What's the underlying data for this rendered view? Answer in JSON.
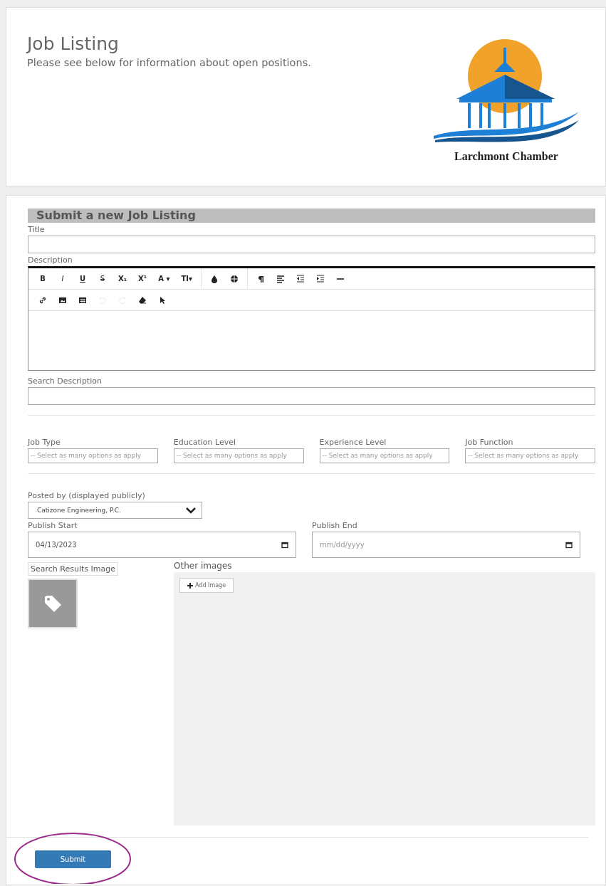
{
  "header": {
    "title": "Job Listing",
    "subtitle": "Please see below for information about open positions.",
    "logo_text": "Larchmont Chamber"
  },
  "form": {
    "heading": "Submit a new Job Listing",
    "title_field": {
      "label": "Title"
    },
    "description": {
      "label": "Description",
      "toolbar": [
        [
          [
            {
              "kind": "bold",
              "label": "B",
              "disabled": false
            },
            {
              "kind": "italic",
              "label": "I",
              "disabled": false
            },
            {
              "kind": "underline",
              "label": "U",
              "disabled": false
            },
            {
              "kind": "strike",
              "label": "S",
              "disabled": false
            },
            {
              "kind": "text",
              "label": "X₁",
              "disabled": false
            },
            {
              "kind": "text",
              "label": "X¹",
              "disabled": false
            },
            {
              "kind": "text",
              "label": "A ▾",
              "disabled": false
            },
            {
              "kind": "text",
              "label": "TI▾",
              "disabled": false
            }
          ],
          [
            {
              "kind": "drop",
              "disabled": false
            },
            {
              "kind": "globe",
              "disabled": false
            }
          ],
          [
            {
              "kind": "paragraph",
              "disabled": false
            },
            {
              "kind": "align",
              "disabled": false
            },
            {
              "kind": "outdent",
              "disabled": false
            },
            {
              "kind": "indent",
              "disabled": false
            },
            {
              "kind": "rule",
              "disabled": false
            }
          ]
        ],
        [
          [
            {
              "kind": "link",
              "disabled": false
            },
            {
              "kind": "image",
              "disabled": false
            },
            {
              "kind": "table",
              "disabled": false
            },
            {
              "kind": "undo",
              "disabled": true
            },
            {
              "kind": "redo",
              "disabled": true
            },
            {
              "kind": "eraser",
              "disabled": false
            },
            {
              "kind": "pointer",
              "disabled": false
            }
          ]
        ]
      ]
    },
    "search_description": {
      "label": "Search Description"
    },
    "multiselects": [
      {
        "label": "Job Type",
        "placeholder": "-- Select as many options as apply"
      },
      {
        "label": "Education Level",
        "placeholder": "-- Select as many options as apply"
      },
      {
        "label": "Experience Level",
        "placeholder": "-- Select as many options as apply"
      },
      {
        "label": "Job Function",
        "placeholder": "-- Select as many options as apply"
      }
    ],
    "posted_by": {
      "label": "Posted by (displayed publicly)",
      "value": "Catizone Engineering, P.C."
    },
    "publish_start": {
      "label": "Publish Start",
      "value": "04/13/2023"
    },
    "publish_end": {
      "label": "Publish End",
      "placeholder": "mm/dd/yyyy"
    },
    "search_results_image": {
      "label": "Search Results Image"
    },
    "other_images": {
      "label": "Other images",
      "button": "Add Image"
    },
    "submit": "Submit"
  }
}
